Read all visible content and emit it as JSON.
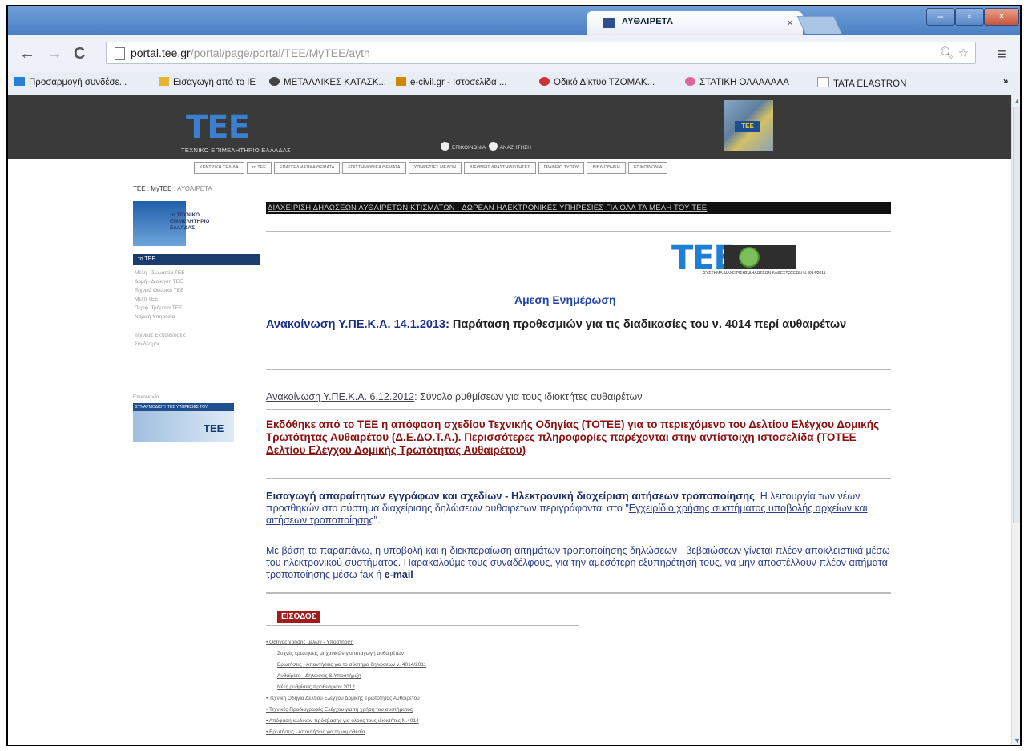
{
  "browser": {
    "tab_title": "ΑΥΘΑΙΡΕΤΑ",
    "tab_close": "×",
    "win_min": "–",
    "win_max": "▫",
    "win_close": "×",
    "url_host": "portal.tee.gr",
    "url_path": "/portal/page/portal/TEE/MyTEE/ayth",
    "bookmarks": [
      {
        "label": "Προσαρμογή συνδέσε...",
        "icon": "apps-icon",
        "color": "#2a7fd6"
      },
      {
        "label": "Εισαγωγή από το IE",
        "icon": "folder-icon",
        "color": "#e8b233"
      },
      {
        "label": "ΜΕΤΑΛΛΙΚΕΣ ΚΑΤΑΣΚ...",
        "icon": "site-icon",
        "color": "#444"
      },
      {
        "label": "e-civil.gr - Ιστοσελίδα ...",
        "icon": "site-icon",
        "color": "#cc8800"
      },
      {
        "label": "Οδικό Δίκτυο ΤΖΟΜΑΚ...",
        "icon": "site-icon",
        "color": "#cc3333"
      },
      {
        "label": "ΣΤΑΤΙΚΗ ΟΛΑΑΑΑΑΑ",
        "icon": "site-icon",
        "color": "#dd6699"
      },
      {
        "label": "TATA ELASTRON",
        "icon": "page-icon",
        "color": "#bbb"
      }
    ],
    "bookmarks_more": "»"
  },
  "site": {
    "logo": "ΤΕΕ",
    "subtitle": "ΤΕΧΝΙΚΟ ΕΠΙΜΕΛΗΤΗΡΙΟ ΕΛΛΑΔΑΣ",
    "header_link_1": "ΕΠΙΚΟΙΝΩΝΙΑ",
    "header_link_2": "ΑΝΑΖΗΤΗΣΗ",
    "photo_tag": "ΤΕΕ",
    "nav": [
      "ΚΕΝΤΡΙΚΗ ΣΕΛΙΔΑ",
      "το ΤΕΕ",
      "ΕΠΑΓΓΕΛΜΑΤΙΚΑ ΘΕΜΑΤΑ",
      "ΕΠΙΣΤΗΜΟΝΙΚΑ ΘΕΜΑΤΑ",
      "ΥΠΗΡΕΣΙΕΣ ΜΕΛΩΝ",
      "ΔΙΕΘΝΕΙΣ ΔΡΑΣΤΗΡΙΟΤΗΤΕΣ",
      "ΓΡΑΦΕΙΟ ΤΥΠΟΥ",
      "ΒΙΒΛΙΟΘΗΚΗ",
      "ΕΠΙΚΟΙΝΩΝΙΑ"
    ]
  },
  "breadcrumb": {
    "a": "ΤΕΕ",
    "sep": " : ",
    "b": "MyTEE",
    "c": "ΑΥΘΑΙΡΕΤΑ"
  },
  "left": {
    "logo_text_1": "το ΤΕΧΝΙΚΟ",
    "logo_text_2": "ΕΠΙΜΕΛΗΤΗΡΙΟ",
    "logo_text_3": "ΕΛΛΑΔΑΣ",
    "menu_head": "το ΤΕΕ",
    "menu_items": [
      "Μέλη - Σωματεία ΤΕΕ",
      "Δομή - Διοίκηση ΤΕΕ",
      "Τεχνικά Θεσμικά ΤΕΕ",
      "Μέλη ΤΕΕ",
      "Περιφ. Τμήματα ΤΕΕ",
      "Νομική Υπηρεσία"
    ],
    "menu_items_2": [
      "Τεχνικές Εκπαιδεύσεις",
      "Συνδέσμοι"
    ],
    "small_label": "Επικοινωνία",
    "banner_bar": "ΣΥΝΑΡΜΟΔΙΟΤΗΤΕΣ ΥΠΗΡΕΣΙΕΣ ΤΟΥ",
    "banner_word": "ΤΕΕ"
  },
  "main": {
    "banner": "ΔΙΑΧΕΙΡΙΣΗ ΔΗΛΩΣΕΩΝ ΑΥΘΑΙΡΕΤΩΝ ΚΤΙΣΜΑΤΩΝ - ΔΩΡΕΑΝ ΗΛΕΚΤΡΟΝΙΚΕΣ ΥΠΗΡΕΣΙΕΣ ΓΙΑ ΟΛΑ ΤΑ ΜΕΛΗ ΤΟΥ ΤΕΕ",
    "logo": "ΤΕΕ",
    "logo_caption": "ΣΥΣΤΗΜΑ ΔΙΑΧΕΙΡΙΣΗΣ ΔΗΛΩΣΕΩΝ ΚΑΘΕΣΤΩΣΕΩΝ Ν.4014/2011",
    "immediate": "Άμεση Ενημέρωση",
    "ann1_link": "Ανακοίνωση Υ.ΠΕ.Κ.Α. 14.1.2013",
    "ann1_text": ": Παράταση προθεσμιών για τις διαδικασίες του ν. 4014 περί αυθαιρέτων",
    "ann2_link": "Ανακοίνωση Υ.ΠΕ.Κ.Α. 6.12.2012",
    "ann2_text": ": Σύνολο ρυθμίσεων για τους ιδιοκτήτες αυθαιρέτων",
    "ann3_text": "Εκδόθηκε από το ΤΕΕ η απόφαση σχεδίου Τεχνικής Οδηγίας (ΤΟΤΕΕ) για το περιεχόμενο του Δελτίου Ελέγχου Δομικής Τρωτότητας Αυθαιρέτου (Δ.Ε.ΔΟ.Τ.Α.). Περισσότερες πληροφορίες παρέχονται στην αντίστοιχη ιστοσελίδα ",
    "ann3_link": "(ΤΟΤΕΕ Δελτίου Ελέγχου Δομικής Τρωτότητας Αυθαιρέτου)",
    "ann4_head": "Εισαγωγή απαραίτητων εγγράφων και σχεδίων - Ηλεκτρονική διαχείριση αιτήσεων τροποποίησης",
    "ann4_text": ": Η λειτουργία των νέων προσθηκών στο σύστημα διαχείρισης δηλώσεων αυθαιρέτων περιγράφονται στο \"",
    "ann4_link": "Εγχειρίδιο χρήσης συστήματος υποβολής αρχείων και αιτήσεων τροποποίησης",
    "ann4_end": "\".",
    "ann5_text": "Με βάση τα παραπάνω, η υποβολή και η διεκπεραίωση αιτημάτων τροποποίησης δηλώσεων - βεβαιώσεων γίνεται πλέον αποκλειστικά μέσω του ηλεκτρονικού συστήματος. Παρακαλούμε τους συναδέλφους, για την αμεσότερη εξυπηρέτησή τους, να μην αποστέλλουν πλέον αιτήματα τροποποίησης μέσω fax ή ",
    "ann5_bold": "e-mail",
    "section": "ΕΙΣΟΔΟΣ",
    "docs": [
      {
        "t": "• Οδηγός χρήσης μελών - Υποστήριξη",
        "indent": false
      },
      {
        "t": "Συχνές ερωτήσεις μηχανικών για υπαγωγή αυθαιρέτων",
        "indent": true
      },
      {
        "t": "Ερωτήσεις - Απαντήσεις για το σύστημα δηλώσεων ν. 4014/2011",
        "indent": true
      },
      {
        "t": "Αυθαίρετα - Δηλώσεις & Υποστήριξη",
        "indent": true
      },
      {
        "t": "Νέες ρυθμίσεις προθεσμιών 2012",
        "indent": true
      },
      {
        "t": "• Τεχνική Οδηγία Δελτίου Ελέγχου Δομικής Τρωτότητας Αυθαιρέτου",
        "indent": false
      },
      {
        "t": "• Τεχνικές Προδιαγραφές Ελέγχου για τη χρήση του συστήματος",
        "indent": false
      },
      {
        "t": "• Απόφαση κωδικών πρόσβασης για όλους τους ιδιοκτήτες Ν.4014",
        "indent": false
      },
      {
        "t": "• Ερωτήσεις - Απαντήσεις για τη νομοθεσία",
        "indent": false
      }
    ]
  }
}
